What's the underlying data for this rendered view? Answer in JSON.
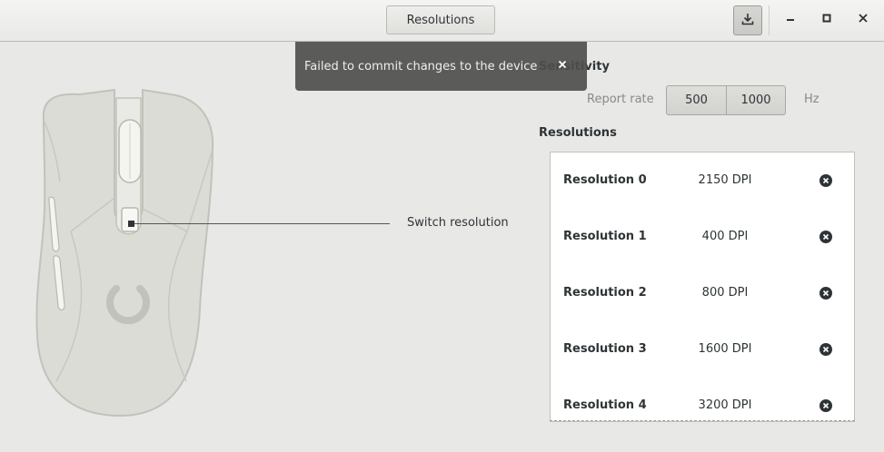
{
  "header": {
    "title_button": "Resolutions",
    "icons": {
      "commit": "download-icon",
      "minimize": "minimize-icon",
      "maximize": "maximize-icon",
      "close": "close-icon"
    }
  },
  "notification": {
    "message": "Failed to commit changes to the device",
    "close_icon": "close-icon"
  },
  "mouse": {
    "leader_label": "Switch resolution"
  },
  "sensitivity": {
    "title": "Sensitivity",
    "report_rate_label": "Report rate",
    "rates": [
      "500",
      "1000"
    ],
    "unit": "Hz"
  },
  "resolutions": {
    "title": "Resolutions",
    "items": [
      {
        "name": "Resolution 0",
        "value": "2150 DPI"
      },
      {
        "name": "Resolution 1",
        "value": "400 DPI"
      },
      {
        "name": "Resolution 2",
        "value": "800 DPI"
      },
      {
        "name": "Resolution 3",
        "value": "1600 DPI"
      },
      {
        "name": "Resolution 4",
        "value": "3200 DPI"
      }
    ],
    "remove_icon": "remove-circle-icon"
  },
  "colors": {
    "background": "#e8e8e7",
    "notification_bg": "#4e4e4e",
    "mouse_body": "#dcdcd6",
    "mouse_stroke": "#c2c2bb"
  }
}
